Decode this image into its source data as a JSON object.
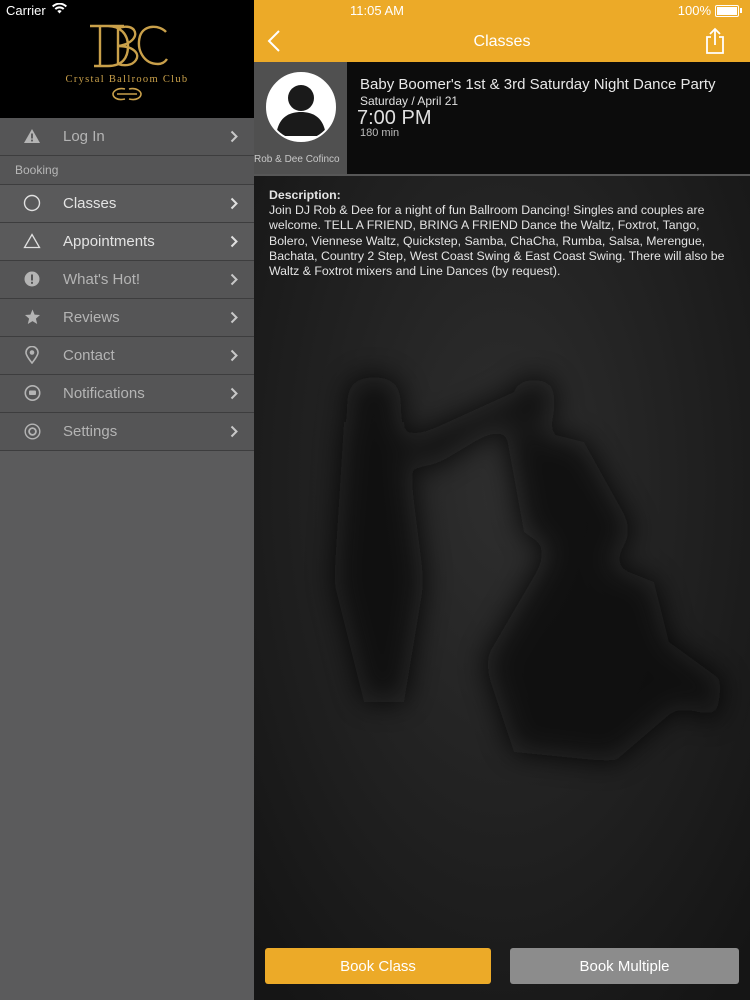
{
  "status_bar": {
    "carrier": "Carrier",
    "time": "11:05 AM",
    "battery": "100%"
  },
  "sidebar": {
    "logo_text": "Crystal Ballroom Club",
    "login": {
      "label": "Log In",
      "icon": "warning-icon"
    },
    "section_label": "Booking",
    "items": [
      {
        "label": "Classes",
        "icon": "circle-icon"
      },
      {
        "label": "Appointments",
        "icon": "triangle-icon"
      },
      {
        "label": "What's Hot!",
        "icon": "alert-icon"
      },
      {
        "label": "Reviews",
        "icon": "star-icon"
      },
      {
        "label": "Contact",
        "icon": "location-pin-icon"
      },
      {
        "label": "Notifications",
        "icon": "chat-bubble-icon"
      },
      {
        "label": "Settings",
        "icon": "gear-icon"
      }
    ]
  },
  "navbar": {
    "title": "Classes"
  },
  "class": {
    "instructor": "Rob & Dee Cofinco",
    "title": "Baby Boomer's 1st & 3rd Saturday Night Dance Party",
    "date": "Saturday / April 21",
    "time": "7:00 PM",
    "duration": "180 min",
    "description_label": "Description:",
    "description": "Join DJ Rob & Dee for a night of fun Ballroom Dancing!   Singles and couples are welcome. TELL A FRIEND, BRING A FRIEND   Dance the Waltz, Foxtrot, Tango, Bolero, Viennese Waltz, Quickstep, Samba, ChaCha, Rumba, Salsa, Merengue, Bachata, Country 2 Step, West Coast Swing & East Coast Swing.   There will also be Waltz & Foxtrot mixers and Line Dances (by request)."
  },
  "buttons": {
    "book_class": "Book Class",
    "book_multiple": "Book Multiple"
  },
  "colors": {
    "accent": "#ecaa28",
    "sidebar": "#555556",
    "logo_gold": "#c9a04a"
  }
}
